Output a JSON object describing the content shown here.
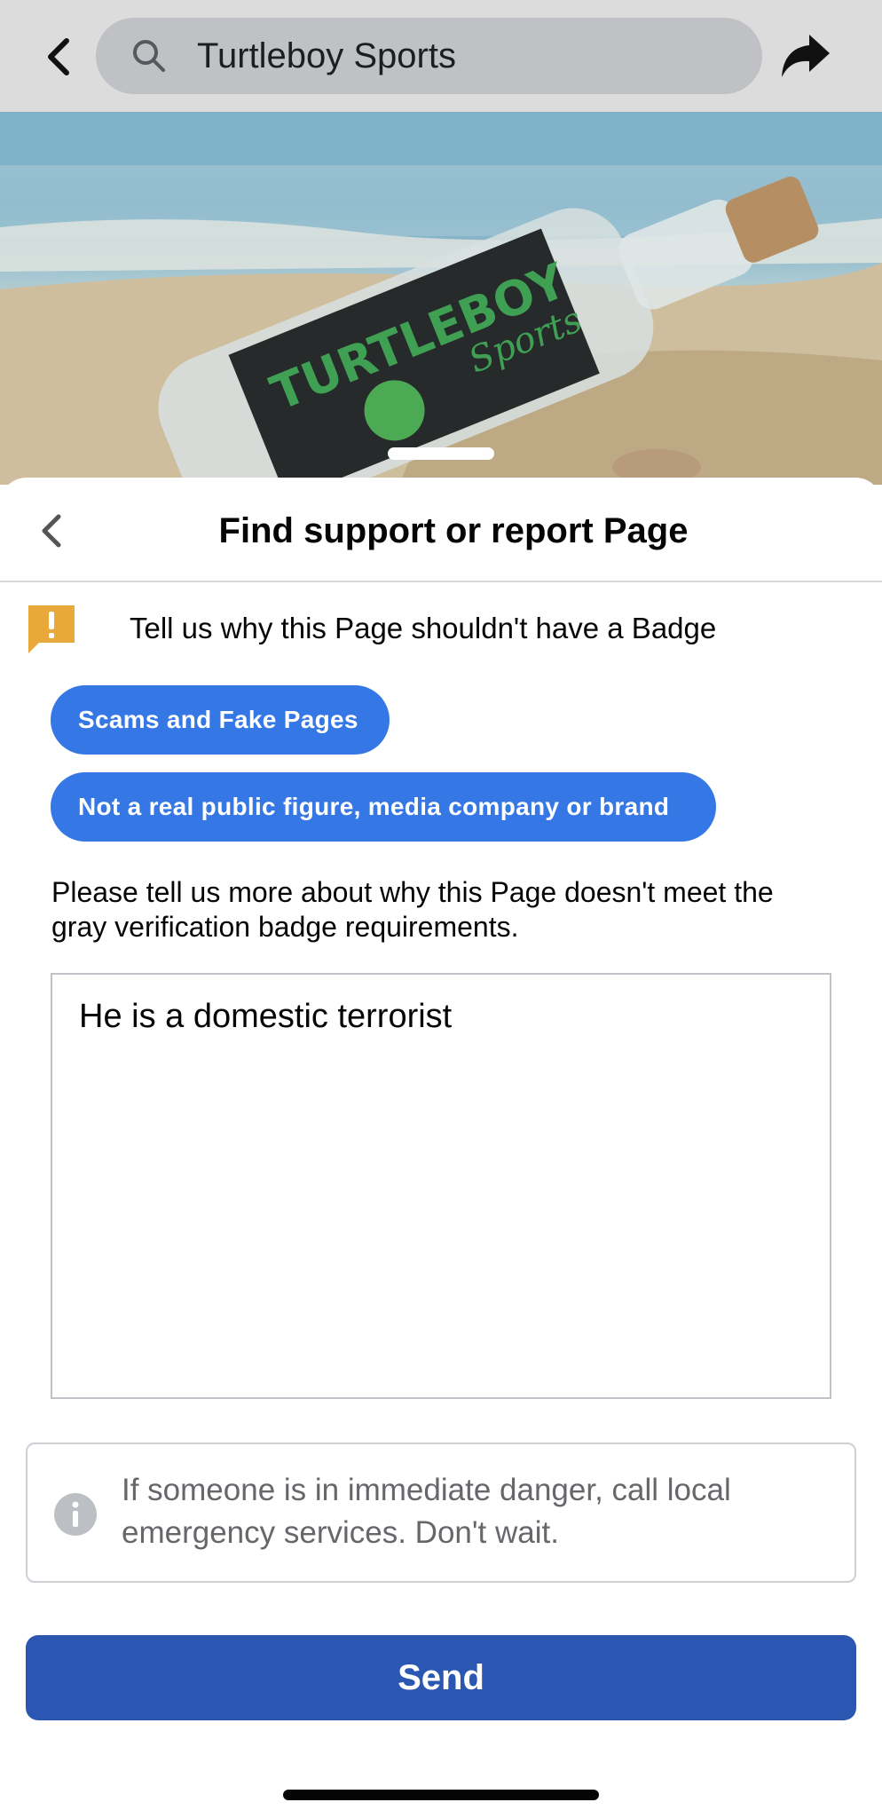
{
  "search": {
    "value": "Turtleboy Sports"
  },
  "cover": {
    "logo_text": "TURTLEBOY",
    "logo_script": "Sports"
  },
  "sheet": {
    "title": "Find support or report Page",
    "prompt": "Tell us why this Page shouldn't have a Badge",
    "chips": [
      {
        "label": "Scams and Fake Pages"
      },
      {
        "label": "Not a real public figure, media company or brand"
      }
    ],
    "instructions": "Please tell us more about why this Page doesn't meet the gray verification badge requirements.",
    "textarea_value": "He is a domestic terrorist",
    "notice": "If someone is in immediate danger, call local emergency services. Don't wait.",
    "send_label": "Send"
  },
  "icons": {
    "back": "chevron-left-icon",
    "search": "search-icon",
    "share": "share-arrow-icon",
    "warning": "warning-flag-icon",
    "info": "info-icon"
  },
  "colors": {
    "chip_blue": "#3578e5",
    "send_blue": "#2b57b3",
    "warning_orange": "#e8a93a",
    "notice_gray": "#65676b"
  }
}
